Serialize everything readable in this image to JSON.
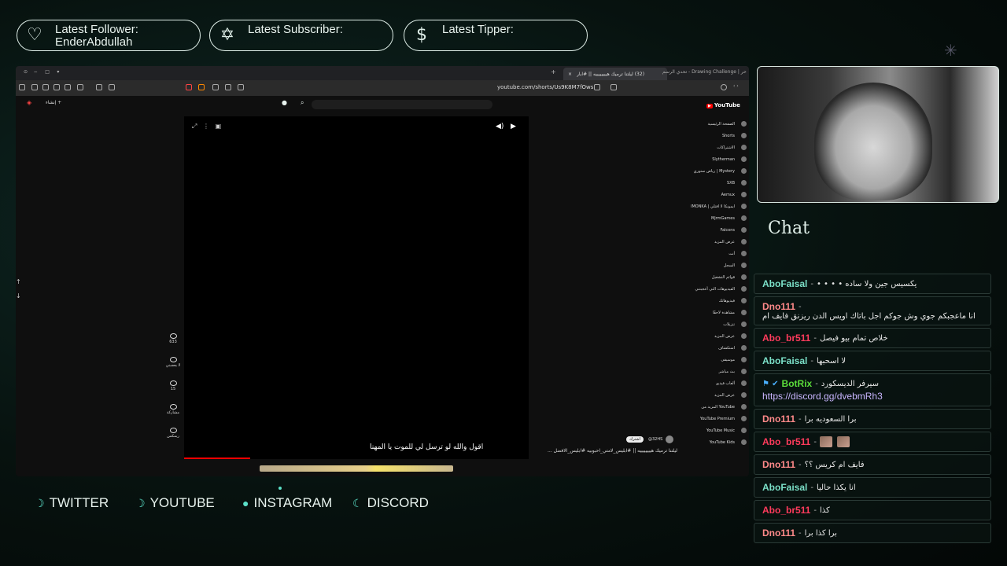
{
  "alerts": {
    "follower_label": "Latest Follower:",
    "follower_name": "EnderAbdullah",
    "subscriber_label": "Latest Subscriber:",
    "tipper_label": "Latest Tipper:"
  },
  "browser": {
    "tab_active": "(32) ليلتنا ترميك هييييييييه || #ابار",
    "tab_other": "تحدي الرسم - Drawing Challenge | حر",
    "url": "youtube.com/shorts/Us9K8M7fOws",
    "nav_add": "+",
    "caption": "اقول والله لو ترسل لي للموت يا المهنا",
    "video_title": "ليلتنا ترميك هييييييييه || #ابليس_لامتي_احبوبيه #ابليس_الافضل ...",
    "channel": "@32HS",
    "subscribe": "اشترك",
    "likes": "633",
    "dislike": "لا يعجبني",
    "comments": "15",
    "share": "مشاركة",
    "remix": "ريمكس"
  },
  "youtube_sidebar": {
    "logo": "YouTube",
    "items": [
      "الصفحة الرئيسية",
      "Shorts",
      "الاشتراكات",
      "Slytherman",
      "رياض ستوري | Mystery",
      "SXB",
      "Aemux",
      "IMONKA | ايمونكا لا افتلي",
      "MjrmGames",
      "Falcons",
      "عرض المزيد",
      "أنت",
      "السجل",
      "قوائم التشغيل",
      "الفيديوهات التي أعجبتني",
      "فيديوهاتك",
      "مشاهدة لاحقًا",
      "تنزيلات",
      "عرض المزيد",
      "استكشاف",
      "موسيقى",
      "بث مباشر",
      "ألعاب فيديو",
      "عرض المزيد",
      "المزيد من YouTube",
      "YouTube Premium",
      "YouTube Music",
      "YouTube Kids"
    ]
  },
  "chat": {
    "title": "Chat",
    "messages": [
      {
        "user": "AboFaisal",
        "color": "#7be0c8",
        "text": "يكسيس جين ولا ساده • • • •"
      },
      {
        "user": "Dno111",
        "color": "#ff8a8a",
        "text": "انا ماعجبكم جوي وش جوكم اجل باتاك اويس الدن ريزنق فايف ام"
      },
      {
        "user": "Abo_br511",
        "color": "#ff3b5c",
        "text": "خلاص تمام بيو فيصل"
      },
      {
        "user": "AboFaisal",
        "color": "#7be0c8",
        "text": "لا اسحبها"
      },
      {
        "user": "BotRix",
        "color": "#5bdc3a",
        "text": "سيرفر الديسكورد",
        "link": "https://discord.gg/dvebmRh3"
      },
      {
        "user": "Dno111",
        "color": "#ff8a8a",
        "text": "برا السعوديه برا"
      },
      {
        "user": "Abo_br511",
        "color": "#ff3b5c",
        "text": ""
      },
      {
        "user": "Dno111",
        "color": "#ff8a8a",
        "text": "فايف ام كريس ؟؟"
      },
      {
        "user": "AboFaisal",
        "color": "#7be0c8",
        "text": "انا يكذا حاليا"
      },
      {
        "user": "Abo_br511",
        "color": "#ff3b5c",
        "text": "كذا"
      },
      {
        "user": "Dno111",
        "color": "#ff8a8a",
        "text": "برا كذا برا"
      }
    ]
  },
  "socials": {
    "twitter": "TWITTER",
    "youtube": "YOUTUBE",
    "instagram": "INSTAGRAM",
    "discord": "DISCORD"
  }
}
